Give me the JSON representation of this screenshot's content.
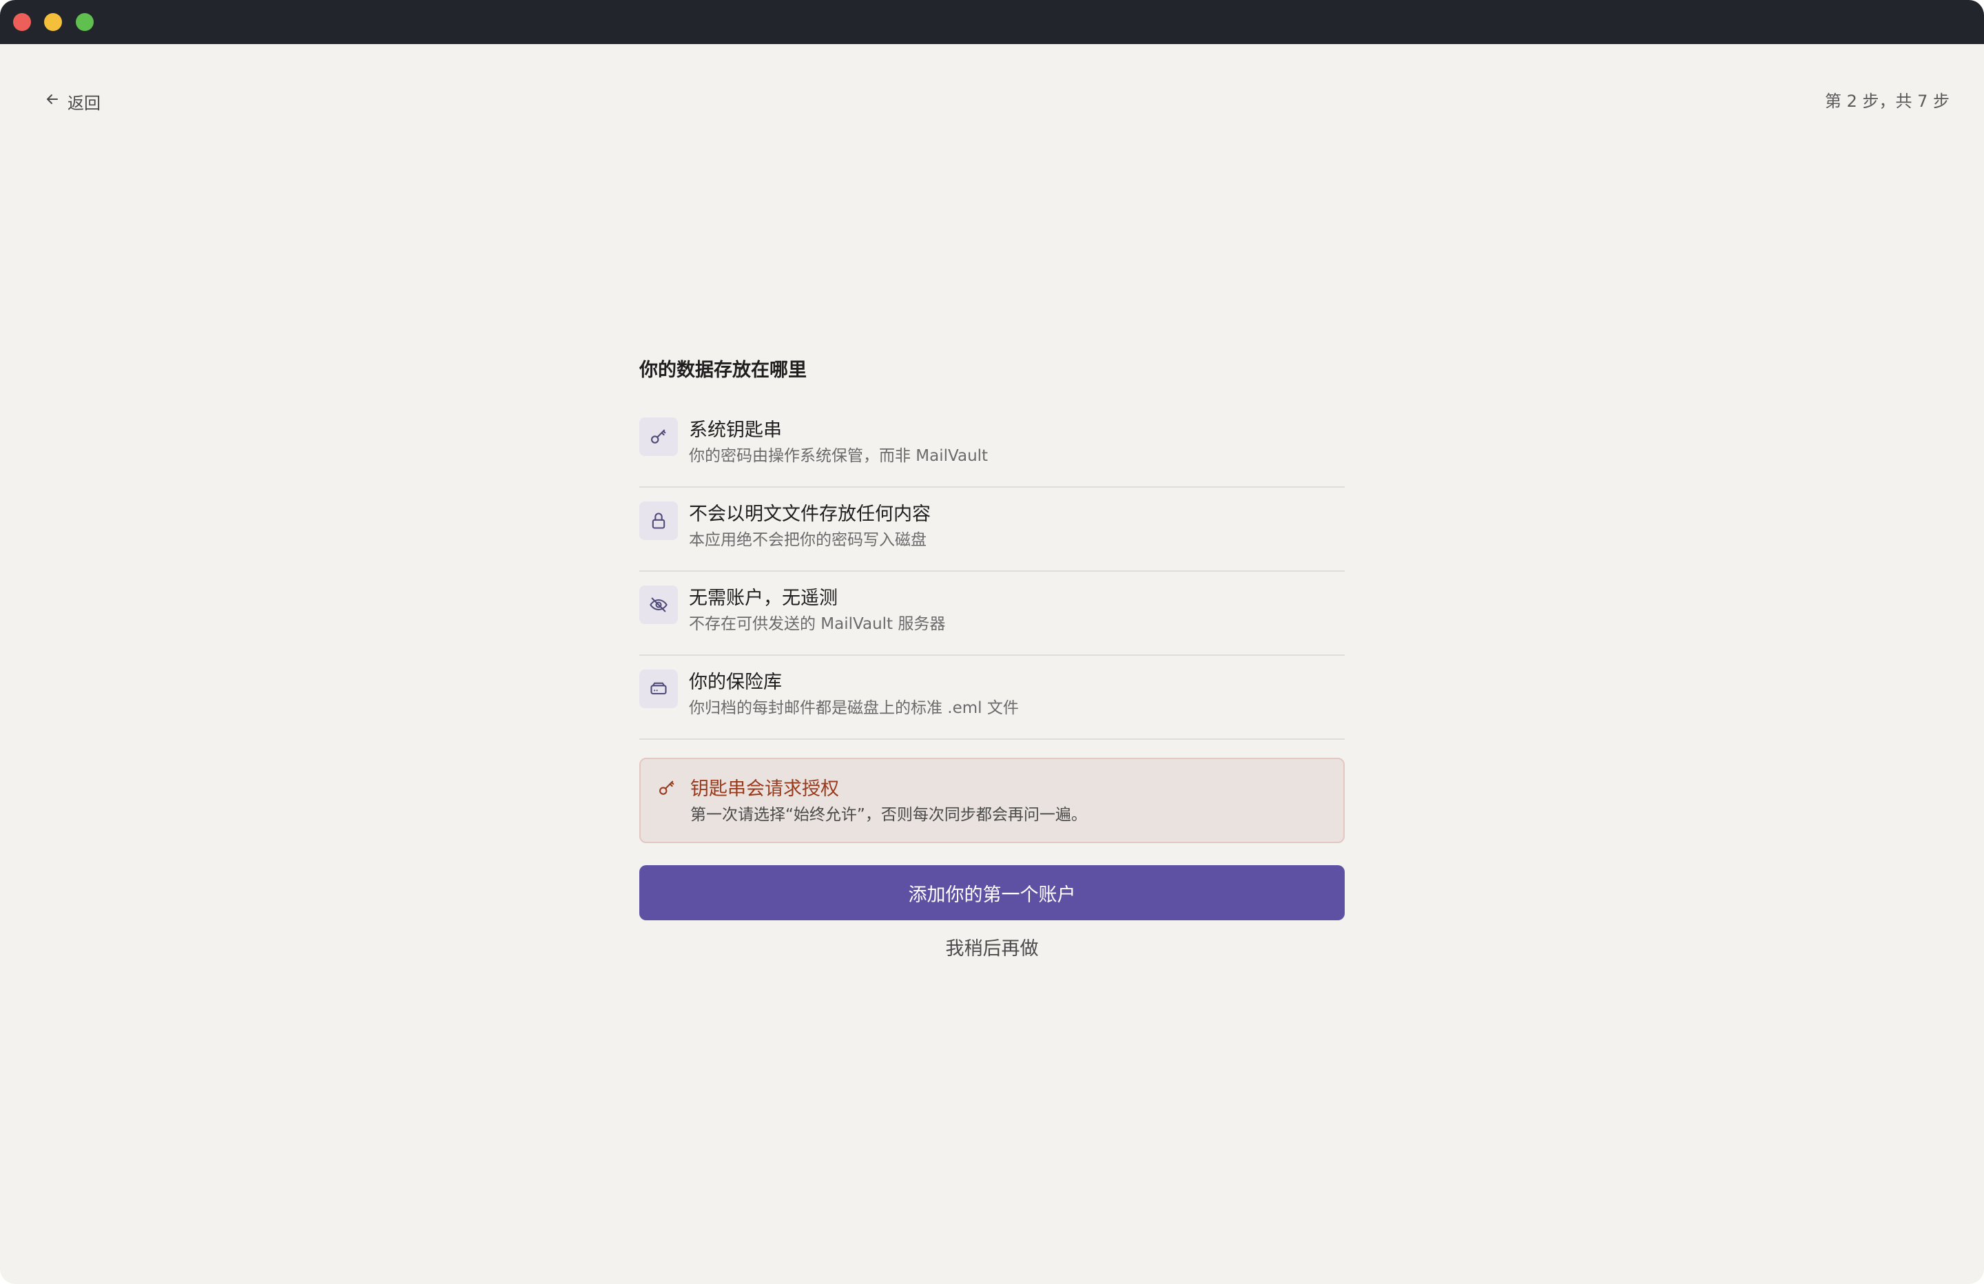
{
  "nav": {
    "back_label": "返回",
    "step_indicator": "第 2 步，共 7 步"
  },
  "section": {
    "title": "你的数据存放在哪里"
  },
  "features": [
    {
      "icon": "key-icon",
      "title": "系统钥匙串",
      "description": "你的密码由操作系统保管，而非 MailVault"
    },
    {
      "icon": "lock-icon",
      "title": "不会以明文文件存放任何内容",
      "description": "本应用绝不会把你的密码写入磁盘"
    },
    {
      "icon": "eye-off-icon",
      "title": "无需账户，无遥测",
      "description": "不存在可供发送的 MailVault 服务器"
    },
    {
      "icon": "hard-drive-icon",
      "title": "你的保险库",
      "description": "你归档的每封邮件都是磁盘上的标准 .eml 文件"
    }
  ],
  "notice": {
    "icon": "key-icon",
    "title": "钥匙串会请求授权",
    "description": "第一次请选择“始终允许”，否则每次同步都会再问一遍。"
  },
  "actions": {
    "primary_label": "添加你的第一个账户",
    "secondary_label": "我稍后再做"
  },
  "colors": {
    "accent": "#5e50a3",
    "background": "#f4f2ef",
    "notice_title": "#9a3a1c",
    "titlebar": "#22252b"
  }
}
